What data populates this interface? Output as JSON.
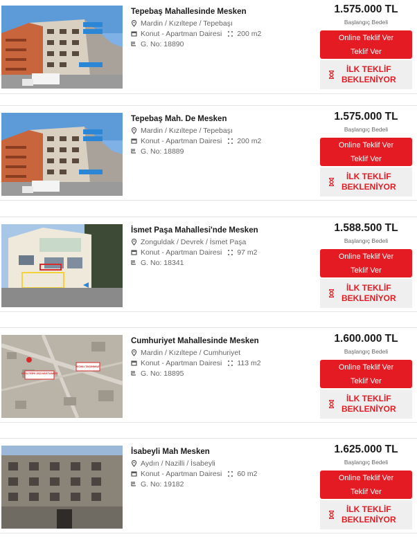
{
  "listings": [
    {
      "title": "Tepebaş Mahallesinde Mesken",
      "location": "Mardin / Kızıltepe / Tepebaşı",
      "type": "Konut - Apartman Dairesi",
      "area": "200 m2",
      "gno": "G. No: 18890",
      "price": "1.575.000 TL",
      "price_label": "Başlangıç Bedeli",
      "offer_line1": "Online Teklif Ver",
      "offer_line2": "Teklif Ver",
      "status_line1": "İLK TEKLİF",
      "status_line2": "BEKLENİYOR",
      "image": "building-photo"
    },
    {
      "title": "Tepebaş Mah. De Mesken",
      "location": "Mardin / Kızıltepe / Tepebaşı",
      "type": "Konut - Apartman Dairesi",
      "area": "200 m2",
      "gno": "G. No: 18889",
      "price": "1.575.000 TL",
      "price_label": "Başlangıç Bedeli",
      "offer_line1": "Online Teklif Ver",
      "offer_line2": "Teklif Ver",
      "status_line1": "İLK TEKLİF",
      "status_line2": "BEKLENİYOR",
      "image": "building-photo"
    },
    {
      "title": "İsmet Paşa Mahallesi'nde Mesken",
      "location": "Zonguldak / Devrek / İsmet Paşa",
      "type": "Konut - Apartman Dairesi",
      "area": "97 m2",
      "gno": "G. No: 18341",
      "price": "1.588.500 TL",
      "price_label": "Başlangıç Bedeli",
      "offer_line1": "Online Teklif Ver",
      "offer_line2": "Teklif Ver",
      "status_line1": "İLK TEKLİF",
      "status_line2": "BEKLENİYOR",
      "image": "house-photo"
    },
    {
      "title": "Cumhuriyet Mahallesinde Mesken",
      "location": "Mardin / Kızıltepe / Cumhuriyet",
      "type": "Konut - Apartman Dairesi",
      "area": "113 m2",
      "gno": "G. No: 18895",
      "price": "1.600.000 TL",
      "price_label": "Başlangıç Bedeli",
      "offer_line1": "Online Teklif Ver",
      "offer_line2": "Teklif Ver",
      "status_line1": "İLK TEKLİF",
      "status_line2": "BEKLENİYOR",
      "image": "map-photo",
      "map_labels": [
        "KIZILTEPE DİŞ HASTANESİ",
        "KONU TAŞINMAZ"
      ]
    },
    {
      "title": "İsabeyli Mah Mesken",
      "location": "Aydın / Nazilli / İsabeyli",
      "type": "Konut - Apartman Dairesi",
      "area": "60 m2",
      "gno": "G. No: 19182",
      "price": "1.625.000 TL",
      "price_label": "Başlangıç Bedeli",
      "offer_line1": "Online Teklif Ver",
      "offer_line2": "Teklif Ver",
      "status_line1": "İLK TEKLİF",
      "status_line2": "BEKLENİYOR",
      "image": "facade-photo"
    }
  ],
  "colors": {
    "accent": "#e41b23",
    "waiting_bg": "#efefef",
    "text": "#1a1a1a",
    "muted": "#666666"
  }
}
